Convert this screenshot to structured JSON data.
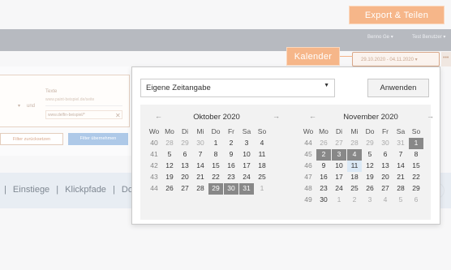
{
  "callouts": {
    "export": "Export & Teilen",
    "kalender": "Kalender"
  },
  "header": {
    "user_menu_1": "Benno Ge ▾",
    "user_menu_2": "Test Benutzer ▾",
    "date_range": "29.10.2020 - 04.11.2020 ▾",
    "more": "•••"
  },
  "filter": {
    "arrow": "▾",
    "und": "und",
    "text_label": "Texte",
    "text_placeholder": "www.paint-beispiel.de/seite",
    "text_value": "www.delfin-beispiel/*",
    "clear": "✕",
    "reset_button": "Filter zurücksetzen",
    "apply_button": "Filter übernehmen"
  },
  "nav": {
    "links": [
      "Einstiege",
      "Klickpfade",
      "Do"
    ]
  },
  "calendar": {
    "preset_select": "Eigene Zeitangabe",
    "apply_button": "Anwenden",
    "weekday_headers": [
      "Wo",
      "Mo",
      "Di",
      "Mi",
      "Do",
      "Fr",
      "Sa",
      "So"
    ],
    "months": [
      {
        "title": "Oktober 2020",
        "weeks": [
          [
            "40",
            "28",
            "29",
            "30",
            "1",
            "2",
            "3",
            "4"
          ],
          [
            "41",
            "5",
            "6",
            "7",
            "8",
            "9",
            "10",
            "11"
          ],
          [
            "42",
            "12",
            "13",
            "14",
            "15",
            "16",
            "17",
            "18"
          ],
          [
            "43",
            "19",
            "20",
            "21",
            "22",
            "23",
            "24",
            "25"
          ],
          [
            "44",
            "26",
            "27",
            "28",
            "29",
            "30",
            "31",
            "1"
          ]
        ]
      },
      {
        "title": "November 2020",
        "weeks": [
          [
            "44",
            "26",
            "27",
            "28",
            "29",
            "30",
            "31",
            "1"
          ],
          [
            "45",
            "2",
            "3",
            "4",
            "5",
            "6",
            "7",
            "8"
          ],
          [
            "46",
            "9",
            "10",
            "11",
            "12",
            "13",
            "14",
            "15"
          ],
          [
            "47",
            "16",
            "17",
            "18",
            "19",
            "20",
            "21",
            "22"
          ],
          [
            "48",
            "23",
            "24",
            "25",
            "26",
            "27",
            "28",
            "29"
          ],
          [
            "49",
            "30",
            "1",
            "2",
            "3",
            "4",
            "5",
            "6"
          ]
        ]
      }
    ],
    "selection": "29.10.2020 - 04.11.2020",
    "today": "11.11.2020"
  },
  "colors": {
    "accent_orange": "#f6b689",
    "selected_day": "#888888",
    "today_highlight": "#dbe9f6"
  }
}
